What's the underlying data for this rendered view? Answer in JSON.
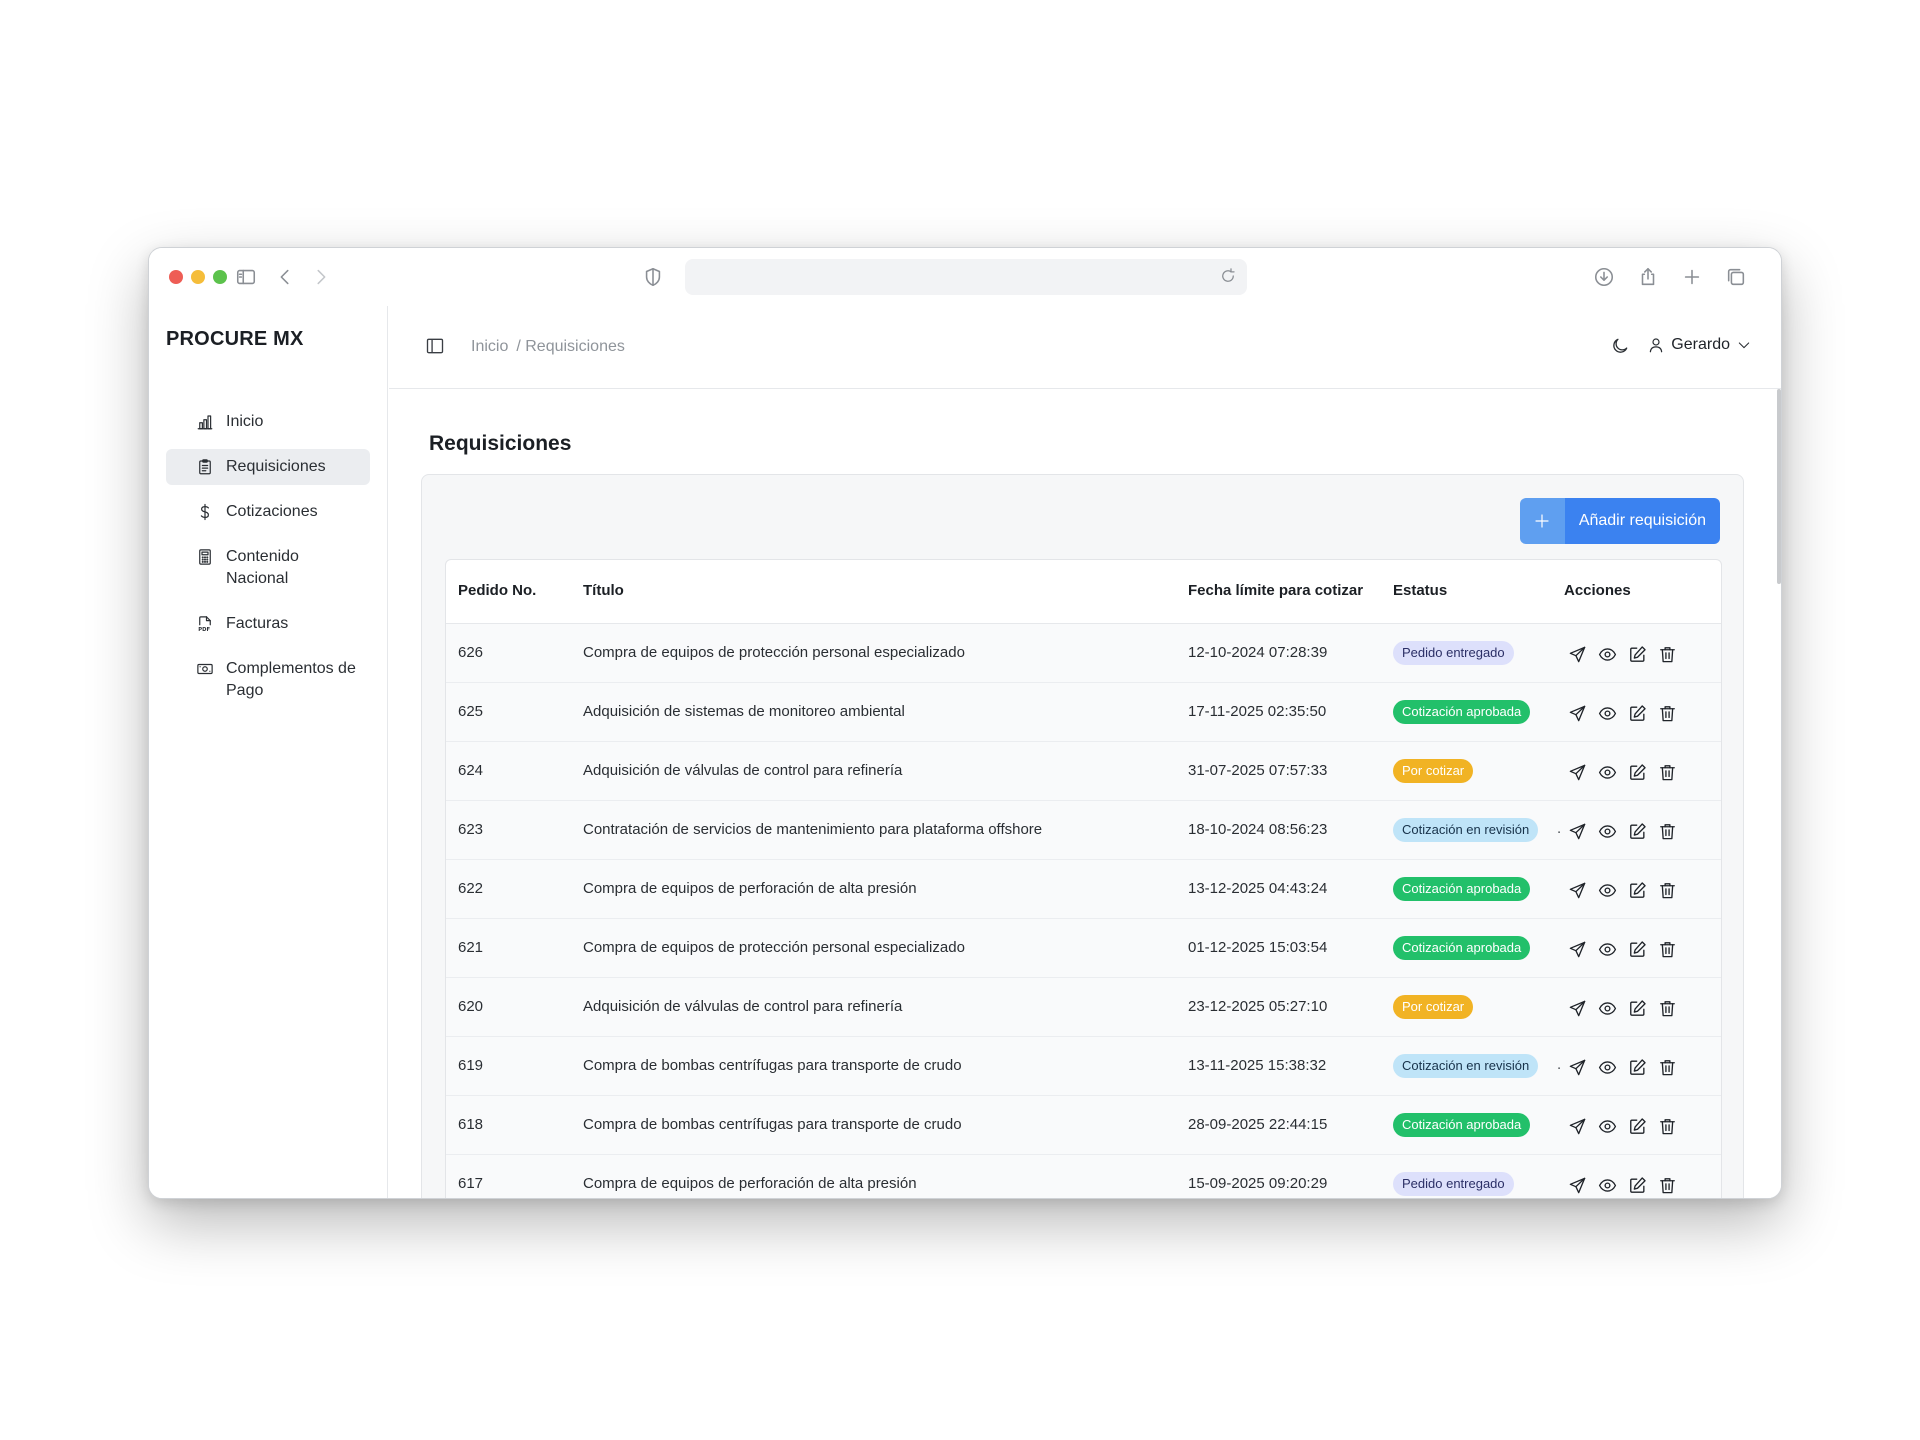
{
  "app": {
    "brand": "PROCURE MX"
  },
  "sidebar": {
    "items": [
      {
        "label": "Inicio",
        "icon": "bar-chart-icon",
        "active": false
      },
      {
        "label": "Requisiciones",
        "icon": "clipboard-icon",
        "active": true
      },
      {
        "label": "Cotizaciones",
        "icon": "dollar-icon",
        "active": false
      },
      {
        "label": "Contenido Nacional",
        "icon": "calculator-icon",
        "active": false
      },
      {
        "label": "Facturas",
        "icon": "pdf-file-icon",
        "active": false
      },
      {
        "label": "Complementos de Pago",
        "icon": "banknote-icon",
        "active": false
      }
    ]
  },
  "header": {
    "breadcrumb": [
      "Inicio",
      "/ Requisiciones"
    ],
    "user_name": "Gerardo"
  },
  "main": {
    "title": "Requisiciones",
    "add_button": "Añadir requisición"
  },
  "table": {
    "columns": [
      "Pedido No.",
      "Título",
      "Fecha límite para cotizar",
      "Estatus",
      "Acciones"
    ],
    "rows": [
      {
        "num": "626",
        "title": "Compra de equipos de protección personal especializado",
        "date": "12-10-2024 07:28:39",
        "status": "Pedido entregado",
        "status_kind": "pedido"
      },
      {
        "num": "625",
        "title": "Adquisición de sistemas de monitoreo ambiental",
        "date": "17-11-2025 02:35:50",
        "status": "Cotización aprobada",
        "status_kind": "aprobada"
      },
      {
        "num": "624",
        "title": "Adquisición de válvulas de control para refinería",
        "date": "31-07-2025 07:57:33",
        "status": "Por cotizar",
        "status_kind": "porcotizar"
      },
      {
        "num": "623",
        "title": "Contratación de servicios de mantenimiento para plataforma offshore",
        "date": "18-10-2024 08:56:23",
        "status": "Cotización en revisión",
        "status_kind": "revision"
      },
      {
        "num": "622",
        "title": "Compra de equipos de perforación de alta presión",
        "date": "13-12-2025 04:43:24",
        "status": "Cotización aprobada",
        "status_kind": "aprobada"
      },
      {
        "num": "621",
        "title": "Compra de equipos de protección personal especializado",
        "date": "01-12-2025 15:03:54",
        "status": "Cotización aprobada",
        "status_kind": "aprobada"
      },
      {
        "num": "620",
        "title": "Adquisición de válvulas de control para refinería",
        "date": "23-12-2025 05:27:10",
        "status": "Por cotizar",
        "status_kind": "porcotizar"
      },
      {
        "num": "619",
        "title": "Compra de bombas centrífugas para transporte de crudo",
        "date": "13-11-2025 15:38:32",
        "status": "Cotización en revisión",
        "status_kind": "revision"
      },
      {
        "num": "618",
        "title": "Compra de bombas centrífugas para transporte de crudo",
        "date": "28-09-2025 22:44:15",
        "status": "Cotización aprobada",
        "status_kind": "aprobada"
      },
      {
        "num": "617",
        "title": "Compra de equipos de perforación de alta presión",
        "date": "15-09-2025 09:20:29",
        "status": "Pedido entregado",
        "status_kind": "pedido"
      }
    ]
  },
  "colors": {
    "accent": "#3b82f0",
    "badge_aprobada": "#22c06a",
    "badge_porcotizar": "#f1b324",
    "badge_revision": "#bfe4f8",
    "badge_pedido": "#dde0fb"
  }
}
